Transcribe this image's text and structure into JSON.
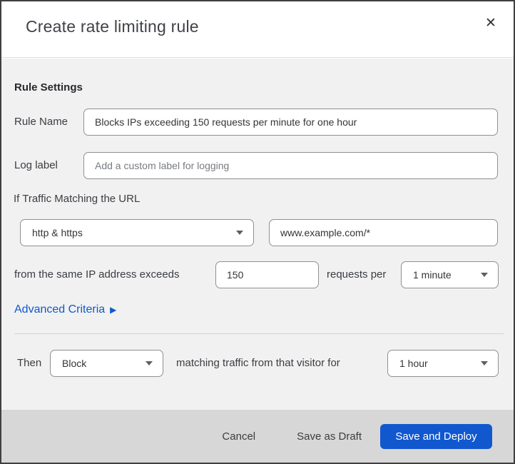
{
  "modal": {
    "title": "Create rate limiting rule",
    "close_icon": "✕"
  },
  "rule_settings": {
    "heading": "Rule Settings",
    "rule_name": {
      "label": "Rule Name",
      "value": "Blocks IPs exceeding 150 requests per minute for one hour"
    },
    "log_label": {
      "label": "Log label",
      "placeholder": "Add a custom label for logging"
    },
    "traffic_match": {
      "intro": "If Traffic Matching the URL",
      "scheme_select": {
        "value": "http & https"
      },
      "url_input": {
        "value": "www.example.com/*"
      }
    },
    "threshold": {
      "prefix": "from the same IP address exceeds",
      "requests_value": "150",
      "middle": "requests per",
      "period_select": {
        "value": "1 minute"
      }
    },
    "advanced_criteria": {
      "label": "Advanced Criteria",
      "arrow_icon": "▶"
    }
  },
  "action": {
    "prefix": "Then",
    "action_select": {
      "value": "Block"
    },
    "middle": "matching traffic from that visitor for",
    "duration_select": {
      "value": "1 hour"
    }
  },
  "footer": {
    "cancel_label": "Cancel",
    "save_draft_label": "Save as Draft",
    "save_deploy_label": "Save and Deploy"
  },
  "colors": {
    "link_blue": "#0f59cd",
    "primary_button_blue": "#1158cf",
    "body_background": "#f1f1f1",
    "footer_background": "#d7d7d7",
    "top_strip_navy": "#12283c"
  }
}
